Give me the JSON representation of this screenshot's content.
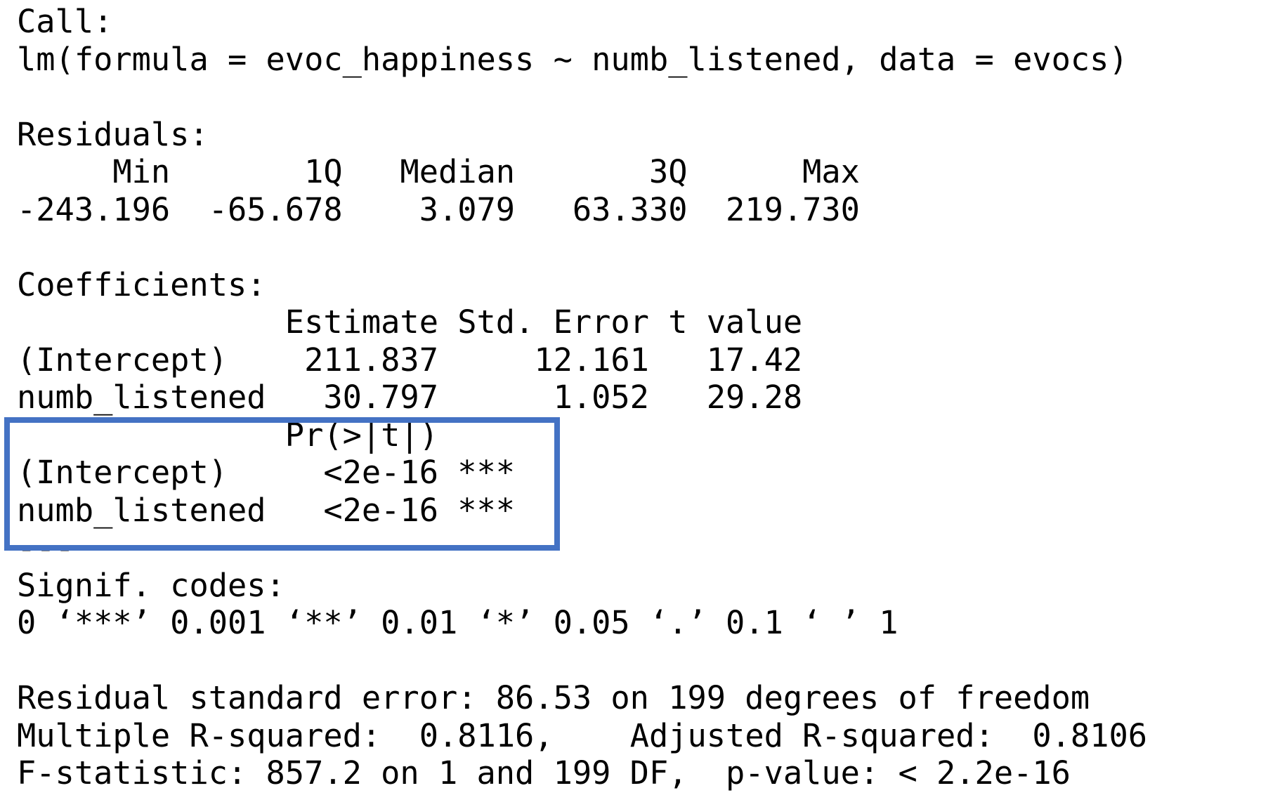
{
  "output": {
    "lines": [
      "Call:",
      "lm(formula = evoc_happiness ~ numb_listened, data = evocs)",
      "",
      "Residuals:",
      "     Min       1Q   Median       3Q      Max ",
      "-243.196  -65.678    3.079   63.330  219.730 ",
      "",
      "Coefficients:",
      "              Estimate Std. Error t value",
      "(Intercept)    211.837     12.161   17.42",
      "numb_listened   30.797      1.052   29.28",
      "              Pr(>|t|)    ",
      "(Intercept)     <2e-16 ***",
      "numb_listened   <2e-16 ***",
      "---",
      "Signif. codes:  ",
      "0 ‘***’ 0.001 ‘**’ 0.01 ‘*’ 0.05 ‘.’ 0.1 ‘ ’ 1",
      "",
      "Residual standard error: 86.53 on 199 degrees of freedom",
      "Multiple R-squared:  0.8116,\tAdjusted R-squared:  0.8106 ",
      "F-statistic: 857.2 on 1 and 199 DF,  p-value: < 2.2e-16"
    ]
  },
  "highlight": {
    "color": "#4472C4"
  }
}
